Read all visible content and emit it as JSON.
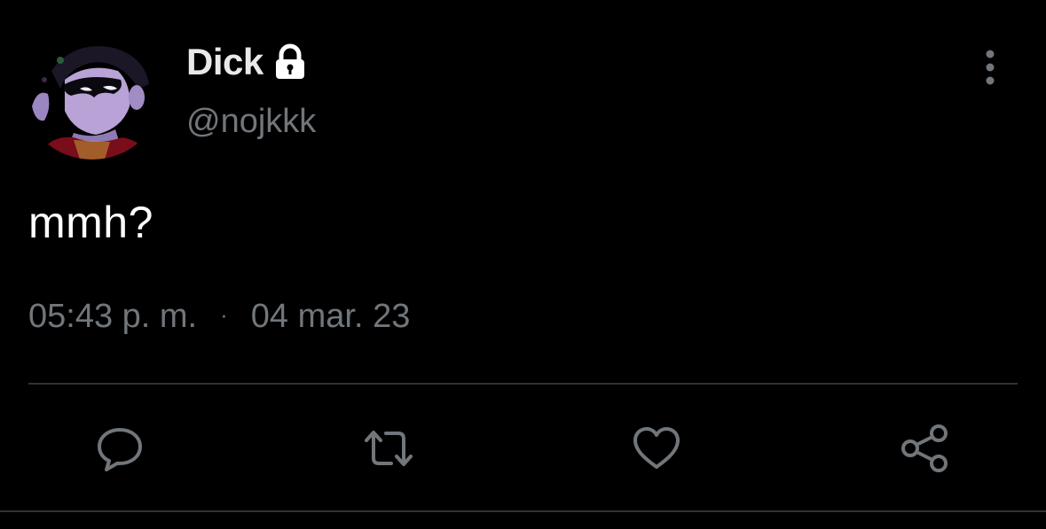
{
  "author": {
    "display_name": "Dick",
    "handle": "@nojkkk",
    "protected_icon": "lock-icon",
    "avatar_alt": "profile avatar"
  },
  "tweet": {
    "text": "mmh?"
  },
  "meta": {
    "time": "05:43 p. m.",
    "separator": "·",
    "date": "04 mar. 23"
  },
  "actions": {
    "reply_icon": "reply-icon",
    "retweet_icon": "retweet-icon",
    "like_icon": "heart-icon",
    "share_icon": "share-icon",
    "more_icon": "more-vertical-icon"
  },
  "colors": {
    "background": "#000000",
    "primary_text": "#e7e9ea",
    "secondary_text": "#71767b",
    "divider": "#2f3336"
  }
}
